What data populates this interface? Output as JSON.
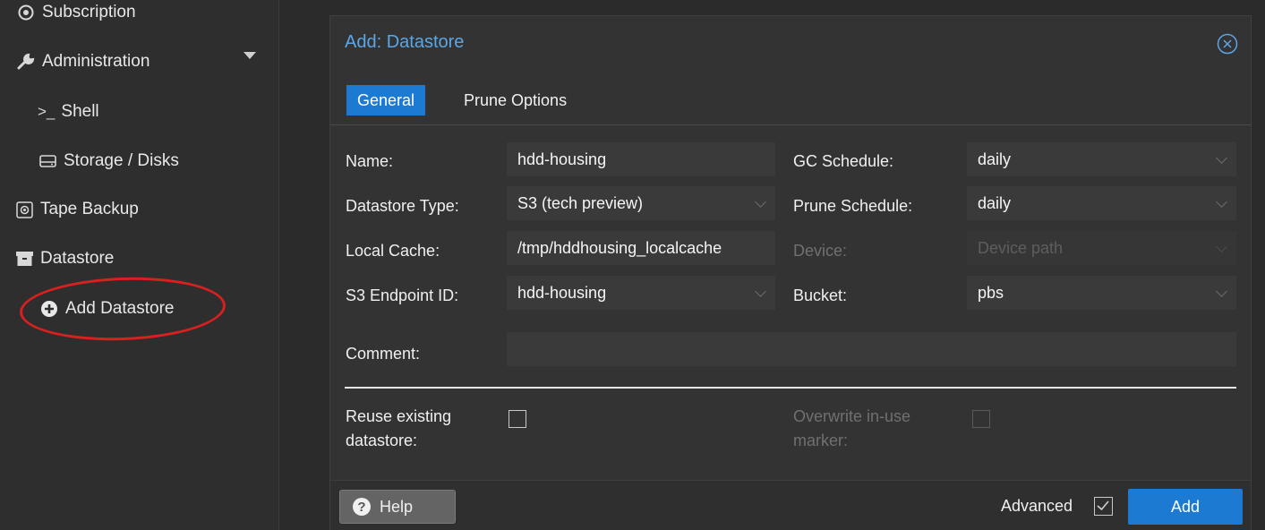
{
  "sidebar": {
    "items": [
      {
        "label": "Subscription",
        "icon": "subscription-icon"
      },
      {
        "label": "Administration",
        "icon": "wrench-icon"
      },
      {
        "label": "Shell",
        "icon": "terminal-icon"
      },
      {
        "label": "Storage / Disks",
        "icon": "hdd-icon"
      },
      {
        "label": "Tape Backup",
        "icon": "tape-icon"
      },
      {
        "label": "Datastore",
        "icon": "archive-icon"
      },
      {
        "label": "Add Datastore",
        "icon": "plus-circle-icon"
      }
    ]
  },
  "dialog": {
    "title": "Add: Datastore",
    "tabs": [
      {
        "label": "General",
        "active": true
      },
      {
        "label": "Prune Options",
        "active": false
      }
    ],
    "fields": {
      "name": {
        "label": "Name:",
        "value": "hdd-housing"
      },
      "datastore_type": {
        "label": "Datastore Type:",
        "value": "S3 (tech preview)"
      },
      "local_cache": {
        "label": "Local Cache:",
        "value": "/tmp/hddhousing_localcache"
      },
      "s3_endpoint": {
        "label": "S3 Endpoint ID:",
        "value": "hdd-housing"
      },
      "gc_schedule": {
        "label": "GC Schedule:",
        "value": "daily"
      },
      "prune_schedule": {
        "label": "Prune Schedule:",
        "value": "daily"
      },
      "device": {
        "label": "Device:",
        "placeholder": "Device path"
      },
      "bucket": {
        "label": "Bucket:",
        "value": "pbs"
      },
      "comment": {
        "label": "Comment:",
        "value": ""
      },
      "reuse": {
        "label": "Reuse existing datastore:",
        "checked": false
      },
      "overwrite": {
        "label": "Overwrite in-use marker:",
        "checked": false
      }
    },
    "footer": {
      "help_label": "Help",
      "advanced_label": "Advanced",
      "advanced_checked": true,
      "add_label": "Add"
    }
  },
  "colors": {
    "accent": "#1d7ad2",
    "title": "#5aa6e6",
    "annotation": "#d9201f"
  }
}
